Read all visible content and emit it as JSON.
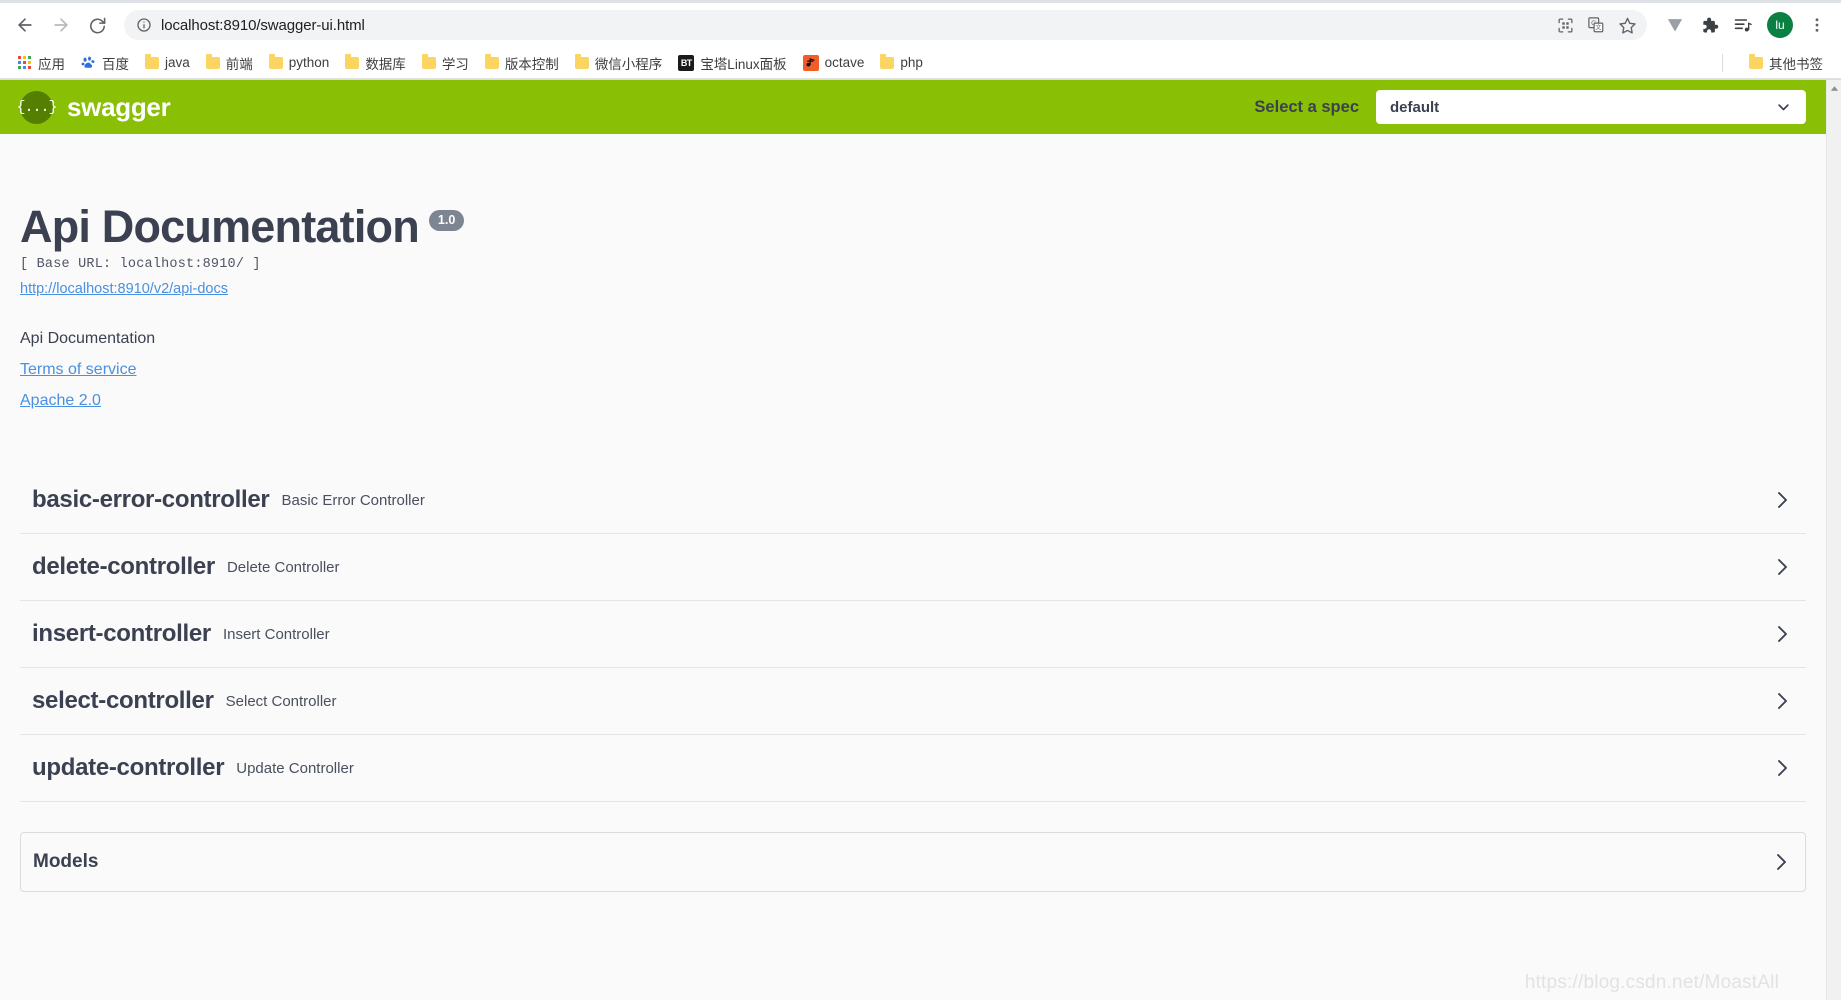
{
  "browser": {
    "back_icon": "back-arrow-icon",
    "forward_icon": "forward-arrow-icon",
    "reload_icon": "reload-icon",
    "site_info_icon": "info-circle-icon",
    "url_bold": "localhost:8910",
    "url_rest": "/swagger-ui.html",
    "url_full": "localhost:8910/swagger-ui.html",
    "omnibox_actions": [
      "qr-code-icon",
      "translate-icon",
      "bookmark-star-icon"
    ],
    "toolbar_actions": [
      "vivaldi-v-icon",
      "extensions-puzzle-icon",
      "media-playlist-icon"
    ],
    "profile_initials": "lu",
    "menu_icon": "three-dot-menu-icon"
  },
  "bookmarks": {
    "items": [
      {
        "label": "应用",
        "icon": "apps-grid-icon"
      },
      {
        "label": "百度",
        "icon": "baidu-paw-icon"
      },
      {
        "label": "java",
        "icon": "folder-icon"
      },
      {
        "label": "前端",
        "icon": "folder-icon"
      },
      {
        "label": "python",
        "icon": "folder-icon"
      },
      {
        "label": "数据库",
        "icon": "folder-icon"
      },
      {
        "label": "学习",
        "icon": "folder-icon"
      },
      {
        "label": "版本控制",
        "icon": "folder-icon"
      },
      {
        "label": "微信小程序",
        "icon": "folder-icon"
      },
      {
        "label": "宝塔Linux面板",
        "icon": "bt-panel-icon"
      },
      {
        "label": "octave",
        "icon": "octave-icon"
      },
      {
        "label": "php",
        "icon": "folder-icon"
      }
    ],
    "other_bookmarks": {
      "label": "其他书签",
      "icon": "folder-icon"
    }
  },
  "swagger": {
    "logo_text": "swagger",
    "logo_mark": "{...}",
    "spec_label": "Select a spec",
    "spec_selected": "default",
    "spec_options": [
      "default"
    ],
    "brand_color": "#89bf04",
    "text_color": "#3b4151",
    "link_color": "#4990e2"
  },
  "info": {
    "title": "Api Documentation",
    "version": "1.0",
    "base_url": "[ Base URL: localhost:8910/ ]",
    "docs_link": "http://localhost:8910/v2/api-docs",
    "description": "Api Documentation",
    "terms_link": "Terms of service",
    "license_link": "Apache 2.0"
  },
  "tags": [
    {
      "name": "basic-error-controller",
      "description": "Basic Error Controller"
    },
    {
      "name": "delete-controller",
      "description": "Delete Controller"
    },
    {
      "name": "insert-controller",
      "description": "Insert Controller"
    },
    {
      "name": "select-controller",
      "description": "Select Controller"
    },
    {
      "name": "update-controller",
      "description": "Update Controller"
    }
  ],
  "models": {
    "title": "Models"
  },
  "watermark": "https://blog.csdn.net/MoastAll"
}
